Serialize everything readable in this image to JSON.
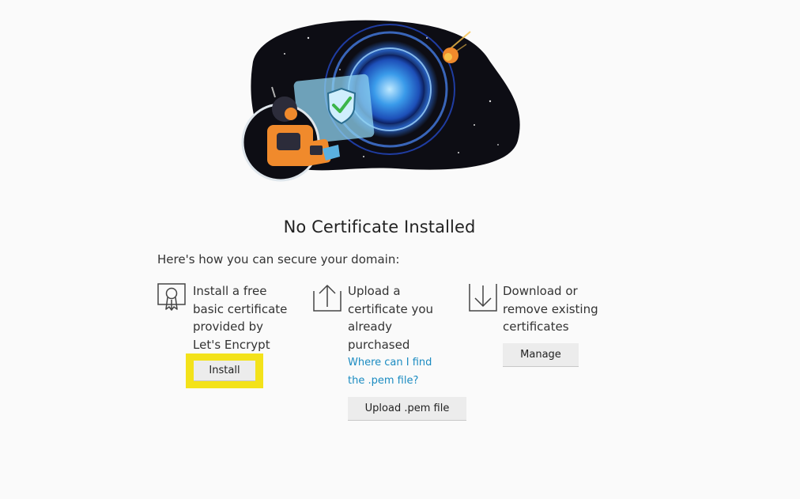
{
  "page": {
    "title": "No Certificate Installed",
    "intro": "Here's how you can secure your domain:"
  },
  "options": [
    {
      "id": "install",
      "icon": "certificate-icon",
      "text": "Install a free\nbasic certificate\nprovided by\nLet's Encrypt",
      "button_label": "Install"
    },
    {
      "id": "upload",
      "icon": "upload-arrow-icon",
      "text": "Upload a\ncertificate you\nalready\npurchased",
      "link_text": "Where can I find\nthe .pem file?",
      "button_label": "Upload .pem file"
    },
    {
      "id": "manage",
      "icon": "download-arrow-icon",
      "text": "Download or\nremove existing\ncertificates",
      "button_label": "Manage"
    }
  ],
  "colors": {
    "highlight": "#f3e21a",
    "link": "#1a8bc1",
    "button_bg": "#ececec",
    "space_bg": "#0d0d14",
    "accent_orange": "#f08a2c",
    "shield_green": "#3bb54a"
  }
}
